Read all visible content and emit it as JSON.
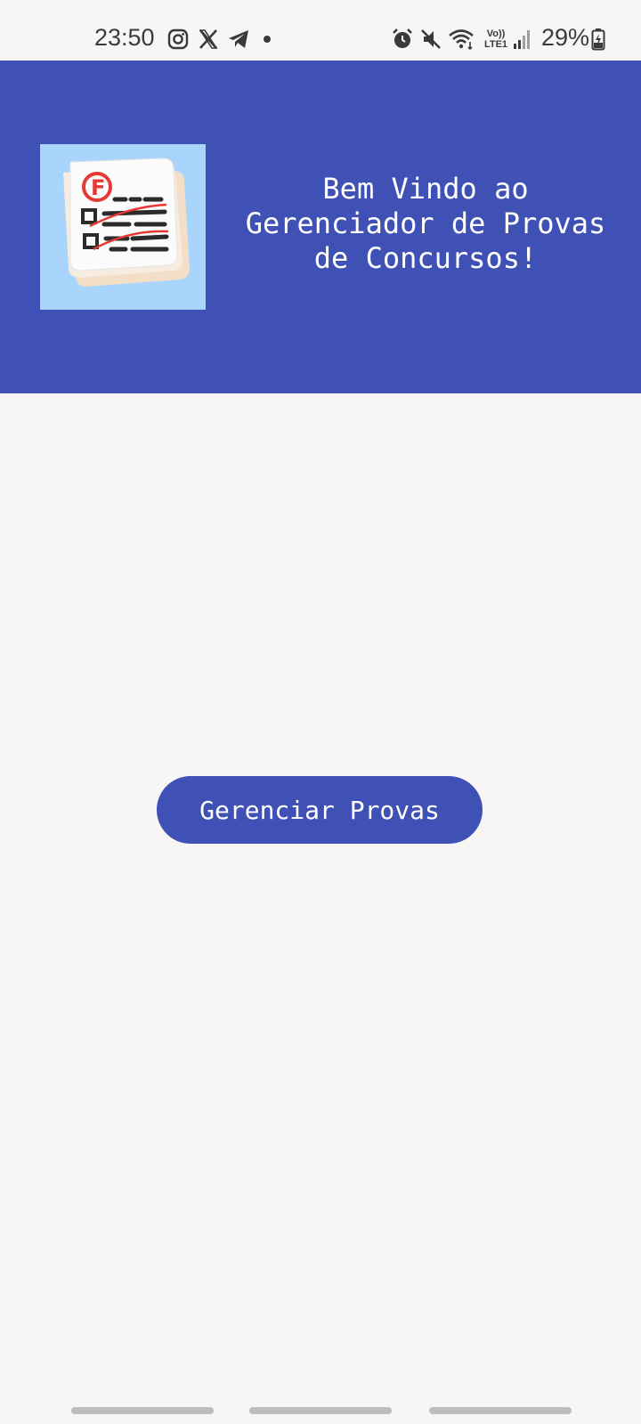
{
  "status_bar": {
    "time": "23:50",
    "battery_percent": "29%",
    "network_label_top": "Vo))",
    "network_label_bottom": "LTE1",
    "notification_icons": [
      "instagram-icon",
      "x-icon",
      "telegram-icon",
      "dot-icon"
    ],
    "system_icons": [
      "alarm-icon",
      "mute-icon",
      "wifi-icon",
      "volte-icon",
      "signal-icon",
      "battery-charging-icon"
    ]
  },
  "header": {
    "background_color": "#3f51b5",
    "logo_icon": "exam-paper-icon",
    "welcome_text": "Bem Vindo ao Gerenciador de Provas de Concursos!"
  },
  "main": {
    "manage_button_label": "Gerenciar Provas",
    "button_color": "#3f51b5"
  },
  "nav_bar": {
    "pills": 3
  }
}
